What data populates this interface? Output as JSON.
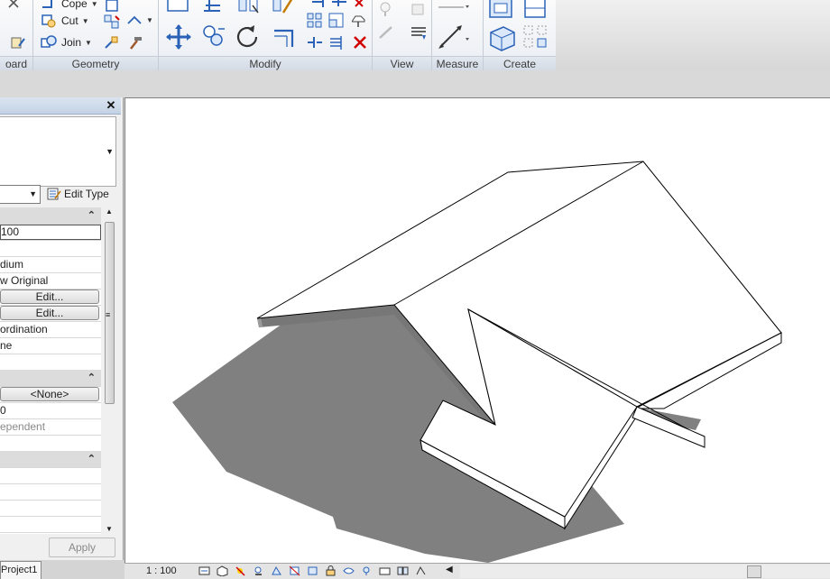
{
  "ribbon": {
    "panels": {
      "clipboard": "oard",
      "geometry": "Geometry",
      "modify": "Modify",
      "view": "View",
      "measure": "Measure",
      "create": "Create"
    },
    "geometry": {
      "cope_label": "Cope",
      "cut_label": "Cut",
      "join_label": "Join"
    }
  },
  "properties": {
    "close_glyph": "✕",
    "edit_type_label": "Edit Type",
    "rows": [
      {
        "kind": "group"
      },
      {
        "kind": "value",
        "text": "100",
        "boxed": true
      },
      {
        "kind": "value",
        "text": ""
      },
      {
        "kind": "value",
        "text": "dium"
      },
      {
        "kind": "value",
        "text": "w Original"
      },
      {
        "kind": "button",
        "text": "Edit..."
      },
      {
        "kind": "button",
        "text": "Edit..."
      },
      {
        "kind": "value",
        "text": "ordination"
      },
      {
        "kind": "value",
        "text": "ne"
      },
      {
        "kind": "value",
        "text": ""
      },
      {
        "kind": "group"
      },
      {
        "kind": "button",
        "text": "<None>"
      },
      {
        "kind": "value",
        "text": "0"
      },
      {
        "kind": "value",
        "text": "ependent",
        "grey": true
      },
      {
        "kind": "value",
        "text": ""
      },
      {
        "kind": "group"
      },
      {
        "kind": "value",
        "text": ""
      },
      {
        "kind": "value",
        "text": ""
      },
      {
        "kind": "value",
        "text": ""
      },
      {
        "kind": "value",
        "text": ""
      }
    ],
    "apply_label": "Apply"
  },
  "project_browser": {
    "tab_label": "Project1"
  },
  "view_control_bar": {
    "scale": "1 : 100"
  },
  "colors": {
    "ribbon_bg": "#eef1f6",
    "shadow": "#808080",
    "model_face": "#ffffff",
    "model_side": "#777777"
  }
}
